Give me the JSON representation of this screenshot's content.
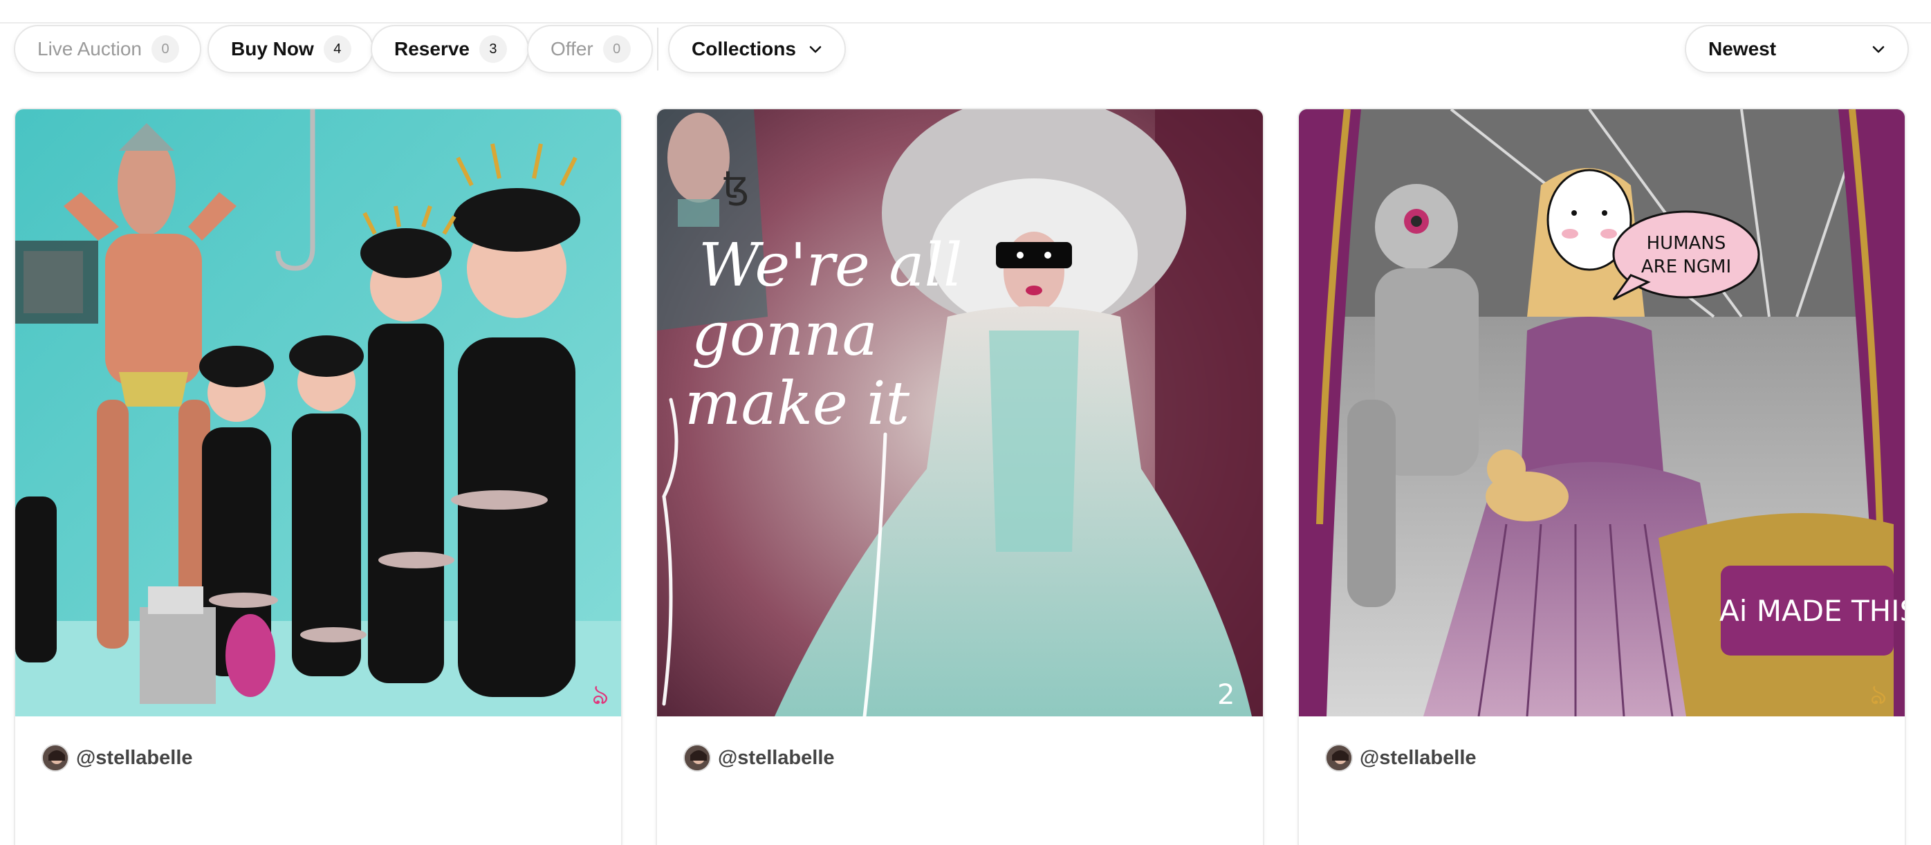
{
  "filters": [
    {
      "label": "Live Auction",
      "count": "0"
    },
    {
      "label": "Buy Now",
      "count": "4"
    },
    {
      "label": "Reserve",
      "count": "3"
    },
    {
      "label": "Offer",
      "count": "0"
    }
  ],
  "collections_label": "Collections",
  "sort_label": "Newest",
  "cards": [
    {
      "creator": "@stellabelle",
      "signature": "ঌ"
    },
    {
      "creator": "@stellabelle",
      "art_text": [
        "We're all",
        "gonna",
        "make it"
      ],
      "corner_mark": "ꜩ",
      "signature": "2"
    },
    {
      "creator": "@stellabelle",
      "speech_bubble": [
        "HUMANS",
        "ARE NGMI"
      ],
      "caption": "Ai MADE THIS",
      "signature": "ঌ"
    }
  ]
}
